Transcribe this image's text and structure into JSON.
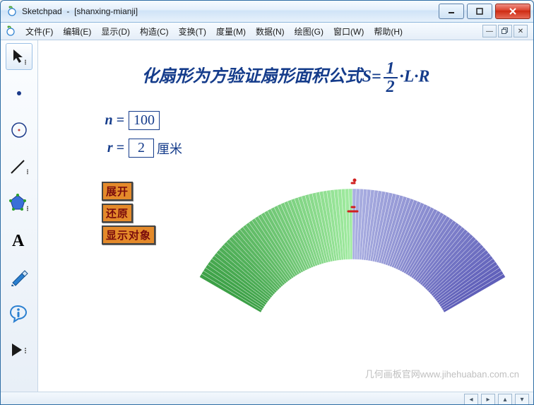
{
  "window": {
    "app": "Sketchpad",
    "doc": "[shanxing-mianji]"
  },
  "menus": {
    "file": "文件(F)",
    "edit": "编辑(E)",
    "display": "显示(D)",
    "construct": "构造(C)",
    "transform": "变换(T)",
    "measure": "度量(M)",
    "data": "数据(N)",
    "graph": "绘图(G)",
    "window": "窗口(W)",
    "help": "帮助(H)"
  },
  "headline": {
    "pre": "化扇形为方验证扇形面积公式S=",
    "frac_num": "1",
    "frac_den": "2",
    "post": "·L·R"
  },
  "params": {
    "n_label": "n =",
    "n_value": "100",
    "r_label": "r =",
    "r_value": "2",
    "r_unit": "厘米"
  },
  "buttons": {
    "expand": "展开",
    "restore": "还原",
    "show": "显示对象"
  },
  "watermark": "几何画板官网www.jihehuaban.com.cn",
  "colors": {
    "accent": "#153c8b",
    "btn_bg": "#e48a2a",
    "btn_text": "#7a0c0c"
  },
  "fan": {
    "segments": 100,
    "half": 50
  }
}
